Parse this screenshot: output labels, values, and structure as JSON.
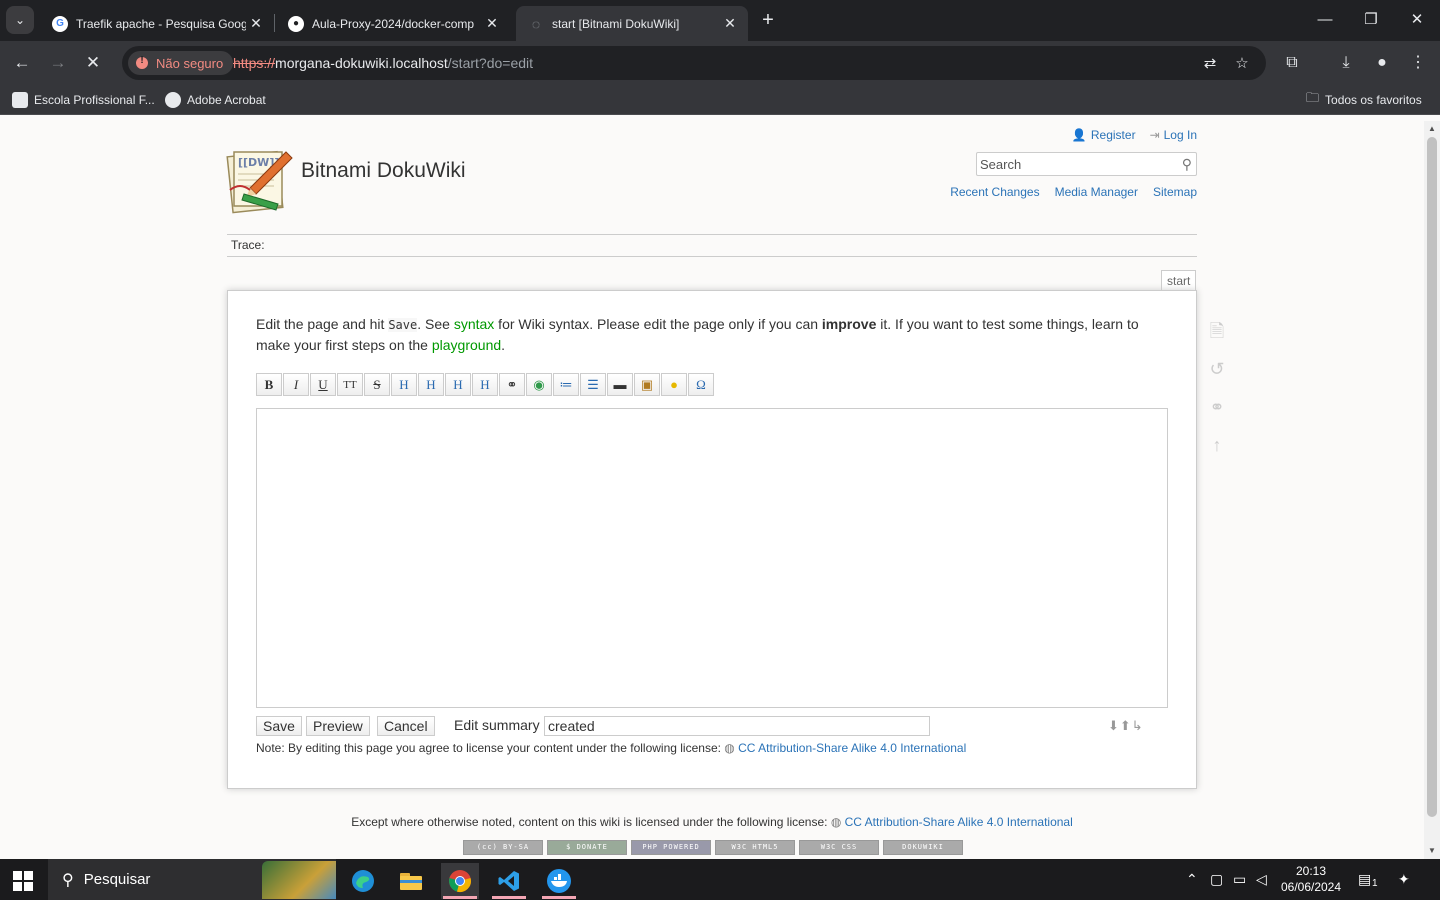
{
  "browser": {
    "tabs": [
      {
        "title": "Traefik apache - Pesquisa Goog",
        "favicon": "google-icon"
      },
      {
        "title": "Aula-Proxy-2024/docker-comp",
        "favicon": "github-icon"
      },
      {
        "title": "start [Bitnami DokuWiki]",
        "favicon": "dokuwiki-icon"
      }
    ],
    "security_label": "Não seguro",
    "url_scheme": "https://",
    "url_host": "morgana-dokuwiki.localhost",
    "url_path": "/start?do=edit",
    "bookmarks": [
      "Escola Profissional F...",
      "Adobe Acrobat"
    ],
    "all_favorites": "Todos os favoritos"
  },
  "wiki": {
    "title": "Bitnami DokuWiki",
    "user_tools": {
      "register": "Register",
      "login": "Log In"
    },
    "search_placeholder": "Search",
    "site_tools": {
      "recent": "Recent Changes",
      "media": "Media Manager",
      "sitemap": "Sitemap"
    },
    "trace_label": "Trace:",
    "page_id": "start",
    "intro": {
      "p1": "Edit the page and hit ",
      "save_code": "Save",
      "p2": ". See ",
      "syntax_link": "syntax",
      "p3": " for Wiki syntax. Please edit the page only if you can ",
      "improve": "improve",
      "p4": " it. If you want to test some things, learn to make your first steps on the ",
      "playground_link": "playground",
      "p5": "."
    },
    "toolbar_buttons": [
      "B",
      "I",
      "U",
      "TT",
      "S",
      "H",
      "H",
      "H",
      "H",
      "link",
      "ext",
      "ol",
      "ul",
      "hr",
      "img",
      "smiley",
      "Ω"
    ],
    "buttons": {
      "save": "Save",
      "preview": "Preview",
      "cancel": "Cancel"
    },
    "summary_label": "Edit summary",
    "summary_value": "created",
    "license_note_prefix": "Note: By editing this page you agree to license your content under the following license:",
    "license_name": "CC Attribution-Share Alike 4.0 International",
    "footer_prefix": "Except where otherwise noted, content on this wiki is licensed under the following license:",
    "badges": [
      "(cc) BY-SA",
      "$ DONATE",
      "PHP POWERED",
      "W3C HTML5",
      "W3C CSS",
      "DOKUWIKI"
    ]
  },
  "taskbar": {
    "search_placeholder": "Pesquisar",
    "time": "20:13",
    "date": "06/06/2024",
    "notifications": "1"
  }
}
